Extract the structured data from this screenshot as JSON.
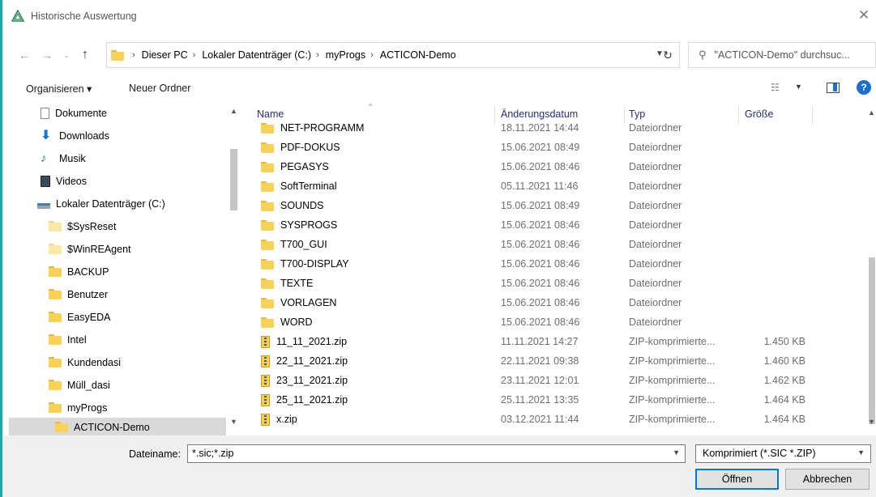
{
  "window": {
    "title": "Historische Auswertung",
    "close_glyph": "✕"
  },
  "address": {
    "crumbs": [
      "Dieser PC",
      "Lokaler Datenträger (C:)",
      "myProgs",
      "ACTICON-Demo"
    ],
    "search_placeholder": "\"ACTICON-Demo\" durchsuc..."
  },
  "toolbar": {
    "organize_label": "Organisieren ▾",
    "new_folder_label": "Neuer Ordner"
  },
  "nav": {
    "items": [
      {
        "label": "Dokumente",
        "icon": "documents-icon"
      },
      {
        "label": "Downloads",
        "icon": "downloads-icon"
      },
      {
        "label": "Musik",
        "icon": "music-icon"
      },
      {
        "label": "Videos",
        "icon": "videos-icon"
      },
      {
        "label": "Lokaler Datenträger (C:)",
        "icon": "drive-icon"
      },
      {
        "label": "$SysReset",
        "icon": "folder-icon"
      },
      {
        "label": "$WinREAgent",
        "icon": "folder-icon"
      },
      {
        "label": "BACKUP",
        "icon": "folder-icon"
      },
      {
        "label": "Benutzer",
        "icon": "folder-icon"
      },
      {
        "label": "EasyEDA",
        "icon": "folder-icon"
      },
      {
        "label": "Intel",
        "icon": "folder-icon"
      },
      {
        "label": "Kundendasi",
        "icon": "folder-icon"
      },
      {
        "label": "Müll_dasi",
        "icon": "folder-icon"
      },
      {
        "label": "myProgs",
        "icon": "folder-icon"
      },
      {
        "label": "ACTICON-Demo",
        "icon": "folder-icon"
      }
    ]
  },
  "columns": {
    "name": "Name",
    "date": "Änderungsdatum",
    "type": "Typ",
    "size": "Größe"
  },
  "files": [
    {
      "name": "NET-PROGRAMM",
      "date": "18.11.2021 14:44",
      "type": "Dateiordner",
      "size": "",
      "kind": "folder"
    },
    {
      "name": "PDF-DOKUS",
      "date": "15.06.2021 08:49",
      "type": "Dateiordner",
      "size": "",
      "kind": "folder"
    },
    {
      "name": "PEGASYS",
      "date": "15.06.2021 08:46",
      "type": "Dateiordner",
      "size": "",
      "kind": "folder"
    },
    {
      "name": "SoftTerminal",
      "date": "05.11.2021 11:46",
      "type": "Dateiordner",
      "size": "",
      "kind": "folder"
    },
    {
      "name": "SOUNDS",
      "date": "15.06.2021 08:49",
      "type": "Dateiordner",
      "size": "",
      "kind": "folder"
    },
    {
      "name": "SYSPROGS",
      "date": "15.06.2021 08:46",
      "type": "Dateiordner",
      "size": "",
      "kind": "folder"
    },
    {
      "name": "T700_GUI",
      "date": "15.06.2021 08:46",
      "type": "Dateiordner",
      "size": "",
      "kind": "folder"
    },
    {
      "name": "T700-DISPLAY",
      "date": "15.06.2021 08:46",
      "type": "Dateiordner",
      "size": "",
      "kind": "folder"
    },
    {
      "name": "TEXTE",
      "date": "15.06.2021 08:46",
      "type": "Dateiordner",
      "size": "",
      "kind": "folder"
    },
    {
      "name": "VORLAGEN",
      "date": "15.06.2021 08:46",
      "type": "Dateiordner",
      "size": "",
      "kind": "folder"
    },
    {
      "name": "WORD",
      "date": "15.06.2021 08:46",
      "type": "Dateiordner",
      "size": "",
      "kind": "folder"
    },
    {
      "name": "11_11_2021.zip",
      "date": "11.11.2021 14:27",
      "type": "ZIP-komprimierte...",
      "size": "1.450 KB",
      "kind": "zip"
    },
    {
      "name": "22_11_2021.zip",
      "date": "22.11.2021 09:38",
      "type": "ZIP-komprimierte...",
      "size": "1.460 KB",
      "kind": "zip"
    },
    {
      "name": "23_11_2021.zip",
      "date": "23.11.2021 12:01",
      "type": "ZIP-komprimierte...",
      "size": "1.462 KB",
      "kind": "zip"
    },
    {
      "name": "25_11_2021.zip",
      "date": "25.11.2021 13:35",
      "type": "ZIP-komprimierte...",
      "size": "1.464 KB",
      "kind": "zip"
    },
    {
      "name": "x.zip",
      "date": "03.12.2021 11:44",
      "type": "ZIP-komprimierte...",
      "size": "1.464 KB",
      "kind": "zip"
    }
  ],
  "footer": {
    "filename_label": "Dateiname:",
    "filename_value": "*.sic;*.zip",
    "filetype_value": "Komprimiert (*.SIC *.ZIP)",
    "open_label": "Öffnen",
    "cancel_label": "Abbrechen"
  }
}
